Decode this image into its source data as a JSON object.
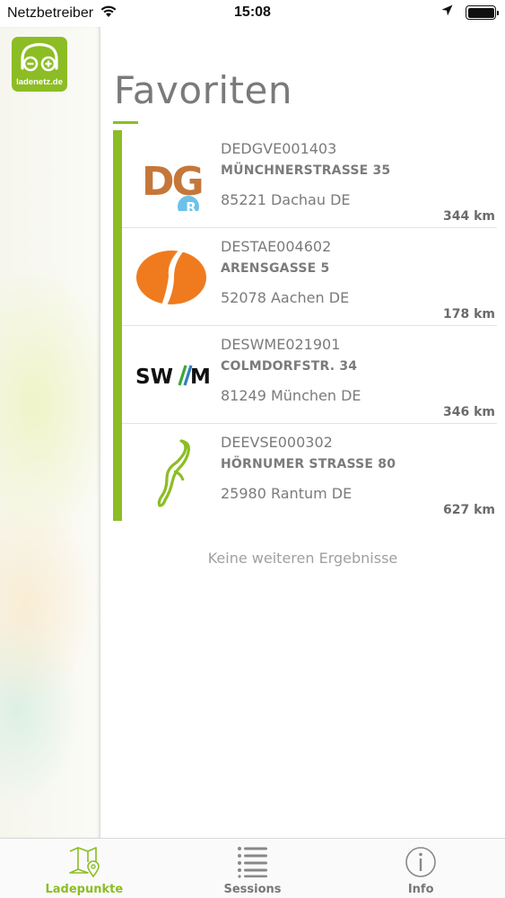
{
  "status_bar": {
    "carrier": "Netzbetreiber",
    "time": "15:08",
    "icons": [
      "wifi-icon",
      "location-arrow-icon",
      "battery-icon"
    ]
  },
  "logo": {
    "text": "ladenetz.de"
  },
  "header": {
    "title": "Favoriten"
  },
  "favorites": [
    {
      "id": "DEDGVE001403",
      "street": "MÜNCHNERSTRASSE 35",
      "city": "85221 Dachau DE",
      "distance": "344 km",
      "logo": "dg-logo",
      "badge": "R"
    },
    {
      "id": "DESTAE004602",
      "street": "ARENSGASSE 5",
      "city": "52078 Aachen DE",
      "distance": "178 km",
      "logo": "stawag-logo"
    },
    {
      "id": "DESWME021901",
      "street": "COLMDORFSTR. 34",
      "city": "81249 München DE",
      "distance": "346 km",
      "logo": "swm-logo",
      "logo_text": "SW/M"
    },
    {
      "id": "DEEVSE000302",
      "street": "HÖRNUMER STRASSE 80",
      "city": "25980 Rantum DE",
      "distance": "627 km",
      "logo": "sylt-logo"
    }
  ],
  "list_footer": "Keine weiteren Ergebnisse",
  "tabs": [
    {
      "label": "Ladepunkte",
      "icon": "map-pin-icon",
      "active": true
    },
    {
      "label": "Sessions",
      "icon": "list-icon",
      "active": false
    },
    {
      "label": "Info",
      "icon": "info-icon",
      "active": false
    }
  ],
  "colors": {
    "accent": "#8cbd24",
    "dg_brown": "#c5773a",
    "badge_blue": "#6cc1ea",
    "stawag_orange": "#f07b1e",
    "swm_green": "#3aa935",
    "swm_blue": "#2f7dc1"
  }
}
